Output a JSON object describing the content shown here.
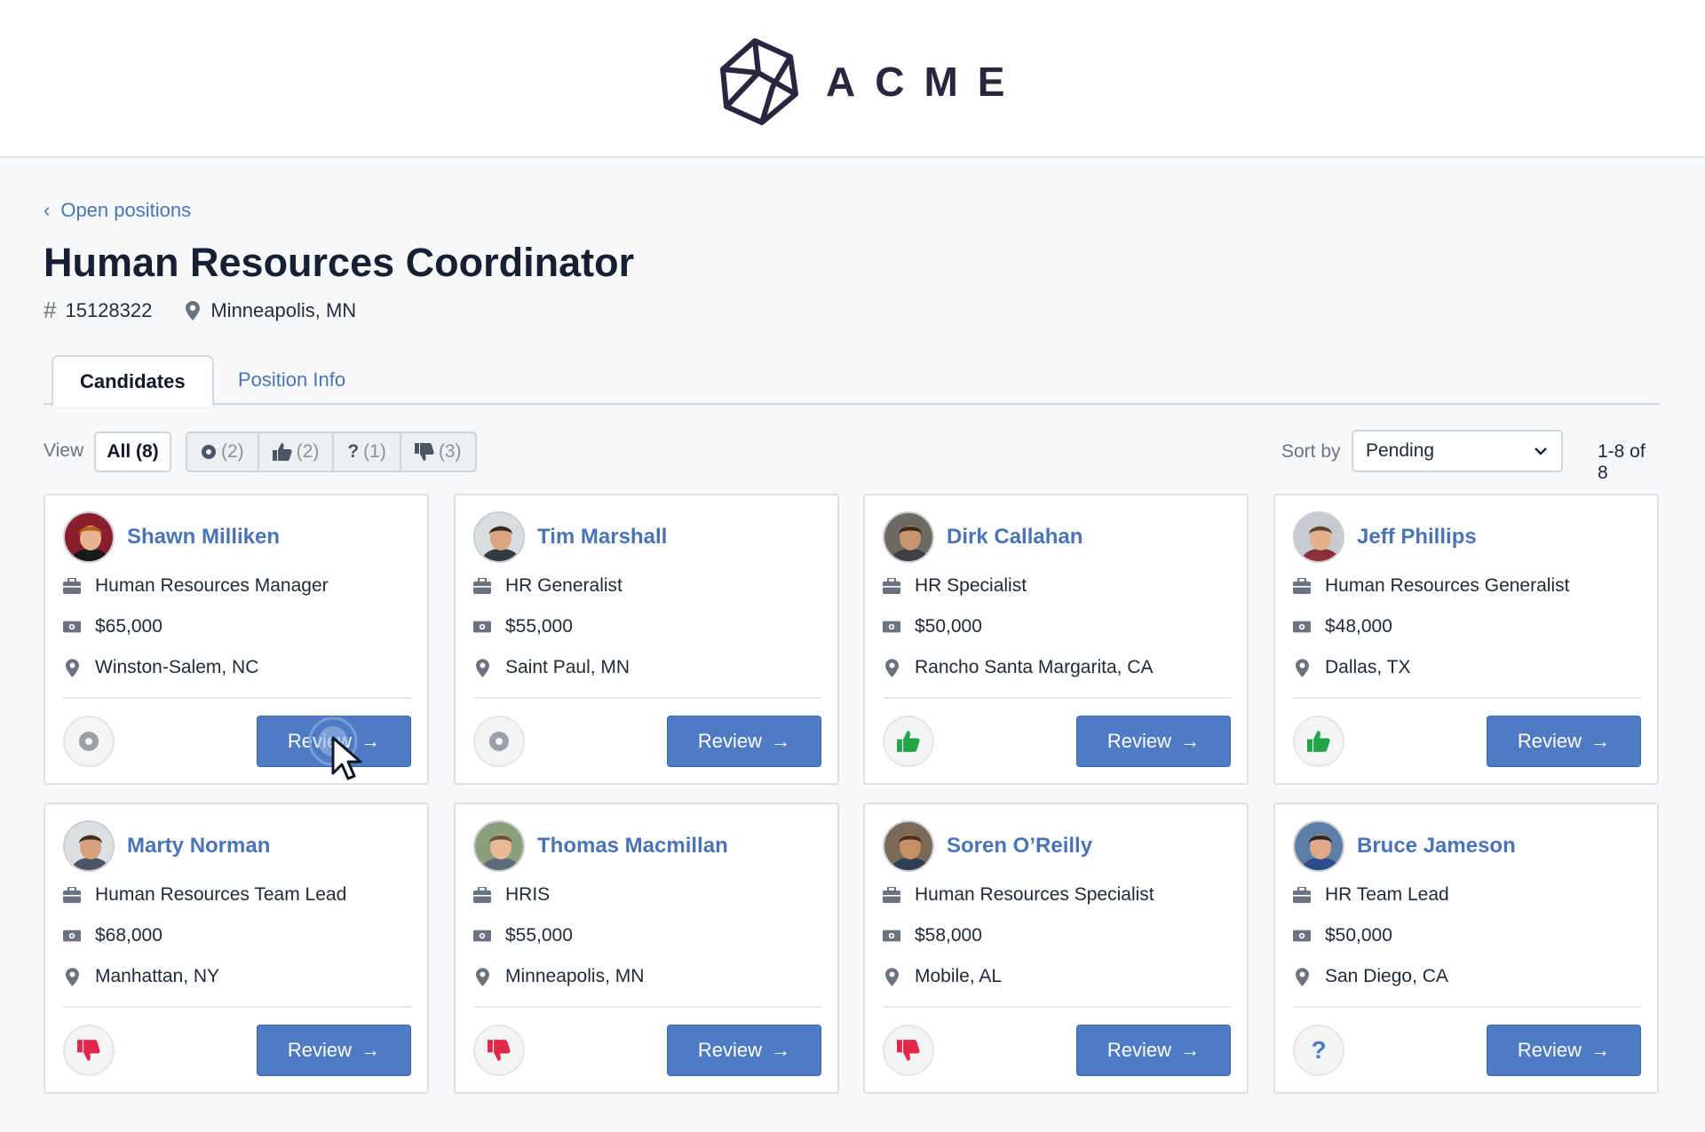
{
  "brand": {
    "name": "ACME"
  },
  "breadcrumb": {
    "label": "Open positions"
  },
  "page": {
    "title": "Human Resources Coordinator",
    "position_id": "15128322",
    "location": "Minneapolis, MN"
  },
  "tabs": [
    {
      "label": "Candidates",
      "active": true
    },
    {
      "label": "Position Info",
      "active": false
    }
  ],
  "filters": {
    "view_label": "View",
    "all": "All (8)",
    "pending": "(2)",
    "thumbs_up": "(2)",
    "question": "(1)",
    "thumbs_down": "(3)"
  },
  "sort": {
    "label": "Sort by",
    "value": "Pending",
    "range": "1-8 of 8"
  },
  "review_label": "Review",
  "colors": {
    "accent": "#4e7bc4",
    "link": "#4a74b6",
    "up": "#22a447",
    "down": "#e0284a",
    "question": "#4e7bc4"
  },
  "candidates": [
    {
      "name": "Shawn Milliken",
      "title": "Human Resources Manager",
      "salary": "$65,000",
      "location": "Winston-Salem, NC",
      "status": "pending"
    },
    {
      "name": "Tim Marshall",
      "title": "HR Generalist",
      "salary": "$55,000",
      "location": "Saint Paul, MN",
      "status": "pending"
    },
    {
      "name": "Dirk Callahan",
      "title": "HR Specialist",
      "salary": "$50,000",
      "location": "Rancho Santa Margarita, CA",
      "status": "thumbs-up"
    },
    {
      "name": "Jeff Phillips",
      "title": "Human Resources Generalist",
      "salary": "$48,000",
      "location": "Dallas, TX",
      "status": "thumbs-up"
    },
    {
      "name": "Marty Norman",
      "title": "Human Resources Team Lead",
      "salary": "$68,000",
      "location": "Manhattan, NY",
      "status": "thumbs-down"
    },
    {
      "name": "Thomas Macmillan",
      "title": "HRIS",
      "salary": "$55,000",
      "location": "Minneapolis, MN",
      "status": "thumbs-down"
    },
    {
      "name": "Soren O’Reilly",
      "title": "Human Resources Specialist",
      "salary": "$58,000",
      "location": "Mobile, AL",
      "status": "thumbs-down"
    },
    {
      "name": "Bruce Jameson",
      "title": "HR Team Lead",
      "salary": "$50,000",
      "location": "San Diego, CA",
      "status": "question"
    }
  ]
}
